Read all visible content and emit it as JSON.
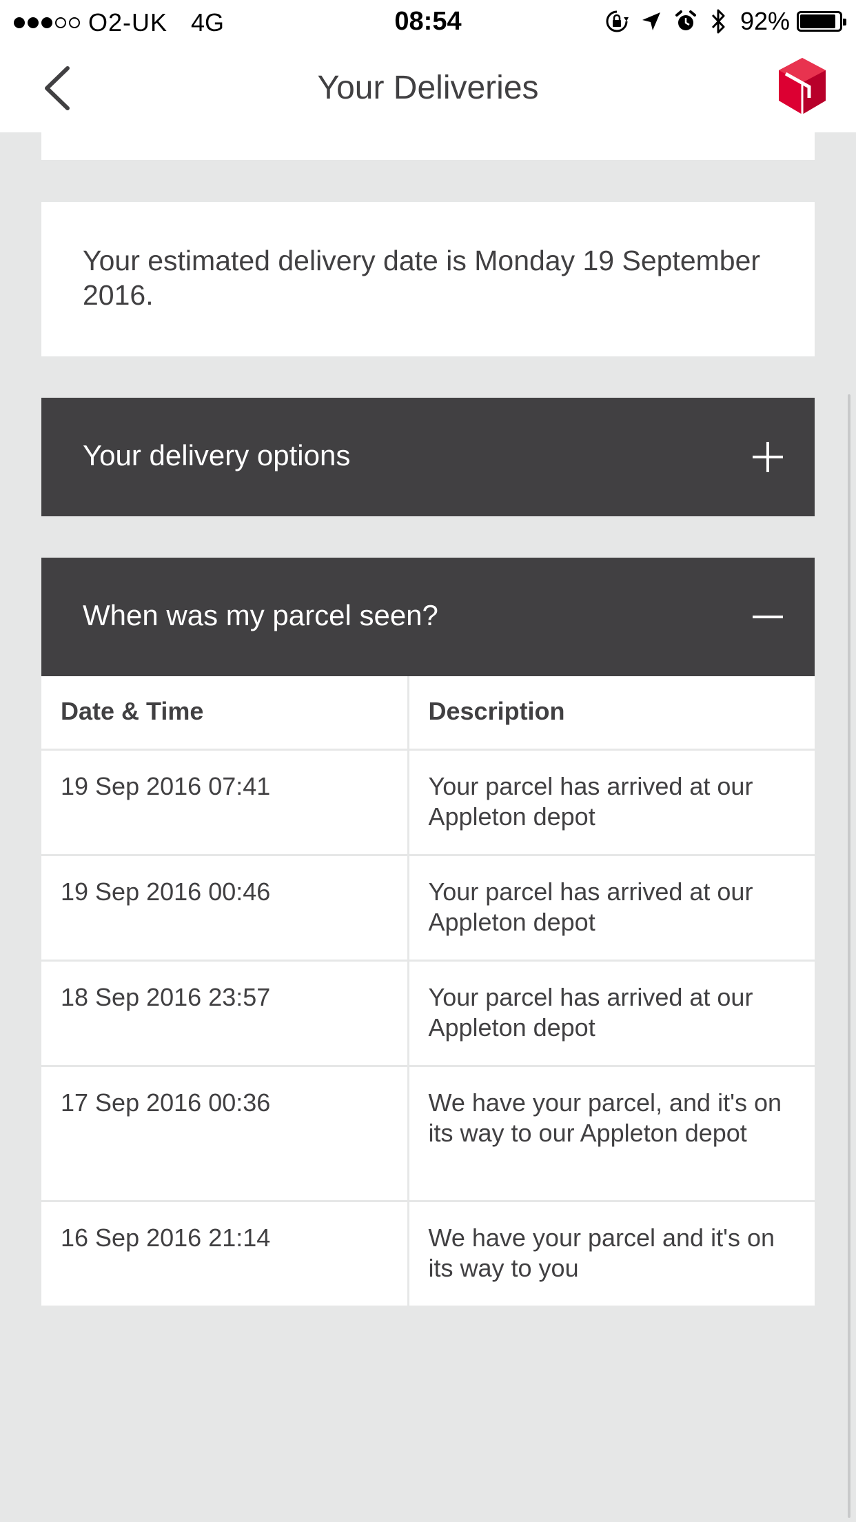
{
  "status_bar": {
    "carrier": "O2-UK",
    "network": "4G",
    "time": "08:54",
    "battery_percent": "92%",
    "battery_level": 0.92,
    "signal_bars_filled": 3,
    "signal_bars_total": 5,
    "icons": [
      "orientation-lock-icon",
      "location-arrow-icon",
      "alarm-icon",
      "bluetooth-icon",
      "battery-icon"
    ]
  },
  "nav": {
    "title": "Your Deliveries",
    "back_icon": "chevron-left-icon",
    "logo": "dpd-logo",
    "brand_color": "#dc0032"
  },
  "estimate": {
    "text": "Your estimated delivery date is Monday 19 September 2016."
  },
  "accordions": {
    "options": {
      "label": "Your delivery options",
      "icon": "plus-icon",
      "expanded": false
    },
    "seen": {
      "label": "When was my parcel seen?",
      "icon": "minus-icon",
      "expanded": true
    }
  },
  "history": {
    "headers": {
      "date": "Date & Time",
      "description": "Description"
    },
    "rows": [
      {
        "date": "19 Sep 2016 07:41",
        "description": "Your parcel has arrived at our Appleton depot"
      },
      {
        "date": "19 Sep 2016 00:46",
        "description": "Your parcel has arrived at our Appleton depot"
      },
      {
        "date": "18 Sep 2016 23:57",
        "description": "Your parcel has arrived at our Appleton depot"
      },
      {
        "date": "17 Sep 2016 00:36",
        "description": "We have your parcel, and it's on its way to our Appleton depot"
      },
      {
        "date": "16 Sep 2016 21:14",
        "description": "We have your parcel and it's on its way to you"
      }
    ]
  },
  "colors": {
    "background": "#e6e7e7",
    "card": "#ffffff",
    "accordion": "#414042",
    "text": "#414042"
  }
}
